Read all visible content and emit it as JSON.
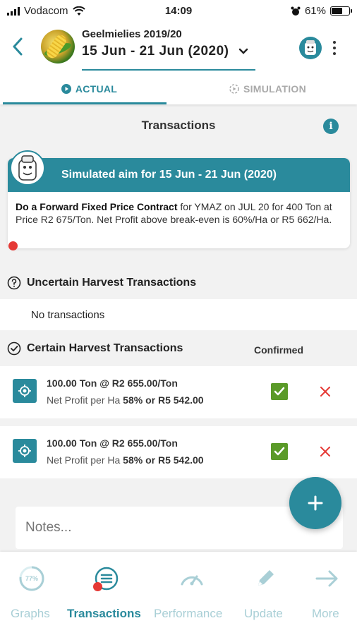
{
  "status_bar": {
    "carrier": "Vodacom",
    "time": "14:09",
    "battery": "61%",
    "battery_level": 0.61
  },
  "header": {
    "farm_name": "Geelmielies 2019/20",
    "period": "15 Jun - 21 Jun (2020)"
  },
  "tabs": [
    {
      "label": "ACTUAL",
      "active": true
    },
    {
      "label": "SIMULATION",
      "active": false
    }
  ],
  "page": {
    "section_title": "Transactions"
  },
  "aim_card": {
    "title": "Simulated aim for 15 Jun - 21 Jun (2020)",
    "action": "Do a Forward Fixed Price Contract",
    "detail": " for YMAZ on JUL 20 for 400 Ton at Price R2 675/Ton. Net Profit above break-even is 60%/Ha or R5 662/Ha."
  },
  "uncertain": {
    "title": "Uncertain Harvest Transactions",
    "empty_text": "No transactions"
  },
  "certain": {
    "title": "Certain Harvest Transactions",
    "confirmed_label": "Confirmed",
    "rows": [
      {
        "line1": "100.00 Ton @ R2 655.00/Ton",
        "profit_prefix": "Net Profit per Ha ",
        "profit_value": "58% or R5 542.00",
        "confirmed": true
      },
      {
        "line1": "100.00 Ton @ R2 655.00/Ton",
        "profit_prefix": "Net Profit per Ha ",
        "profit_value": "58% or R5 542.00",
        "confirmed": true
      }
    ]
  },
  "notes": {
    "placeholder": "Notes..."
  },
  "bottom_nav": [
    {
      "label": "Graphs",
      "badge": "77%",
      "icon": "gauge-percent-icon"
    },
    {
      "label": "Transactions",
      "icon": "list-icon",
      "active": true
    },
    {
      "label": "Performance",
      "icon": "speedometer-icon"
    },
    {
      "label": "Update",
      "icon": "pencil-icon"
    },
    {
      "label": "More",
      "icon": "arrow-right-icon"
    }
  ],
  "colors": {
    "primary": "#2a8a9c",
    "confirm": "#5a9a28",
    "delete": "#e53935",
    "nav_inactive": "#a9cfd6"
  }
}
